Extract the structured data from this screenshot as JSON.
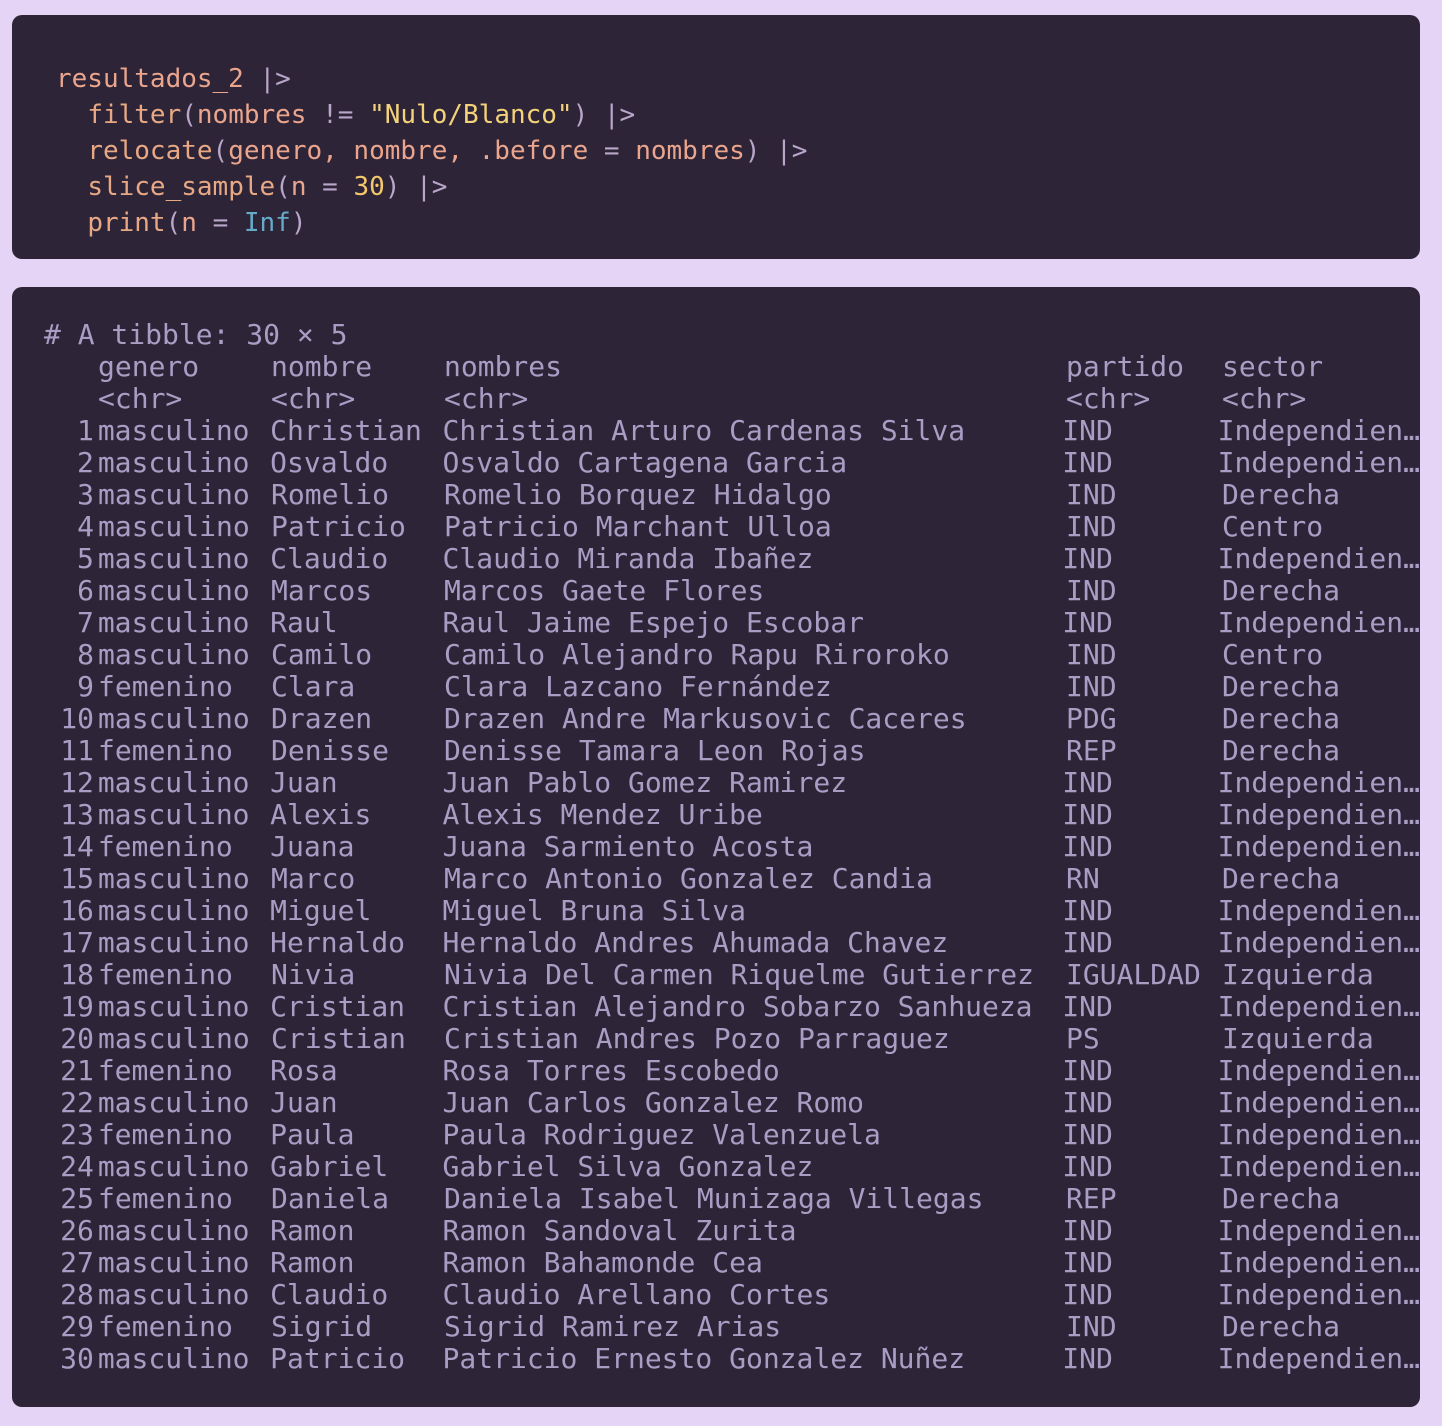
{
  "code": {
    "object": "resultados_2",
    "pipe": "|>",
    "filter_fn": "filter",
    "filter_col": "nombres",
    "filter_op": "!=",
    "filter_value": "\"Nulo/Blanco\"",
    "relocate_fn": "relocate",
    "relocate_args": "genero, nombre, .before",
    "relocate_eq": "=",
    "relocate_target": "nombres",
    "slice_fn": "slice_sample",
    "slice_arg": "n",
    "slice_eq": "=",
    "slice_value": "30",
    "print_fn": "print",
    "print_arg": "n",
    "print_eq": "=",
    "print_value": "Inf"
  },
  "output": {
    "header": "# A tibble: 30 × 5",
    "columns": [
      "genero",
      "nombre",
      "nombres",
      "partido",
      "sector"
    ],
    "types": [
      "<chr>",
      "<chr>",
      "<chr>",
      "<chr>",
      "<chr>"
    ],
    "rows": [
      [
        "1",
        "masculino",
        "Christian",
        "Christian Arturo Cardenas Silva",
        "IND",
        "Independien…"
      ],
      [
        "2",
        "masculino",
        "Osvaldo",
        "Osvaldo Cartagena Garcia",
        "IND",
        "Independien…"
      ],
      [
        "3",
        "masculino",
        "Romelio",
        "Romelio Borquez Hidalgo",
        "IND",
        "Derecha"
      ],
      [
        "4",
        "masculino",
        "Patricio",
        "Patricio Marchant Ulloa",
        "IND",
        "Centro"
      ],
      [
        "5",
        "masculino",
        "Claudio",
        "Claudio Miranda Ibañez",
        "IND",
        "Independien…"
      ],
      [
        "6",
        "masculino",
        "Marcos",
        "Marcos Gaete Flores",
        "IND",
        "Derecha"
      ],
      [
        "7",
        "masculino",
        "Raul",
        "Raul Jaime Espejo Escobar",
        "IND",
        "Independien…"
      ],
      [
        "8",
        "masculino",
        "Camilo",
        "Camilo Alejandro Rapu Riroroko",
        "IND",
        "Centro"
      ],
      [
        "9",
        "femenino",
        "Clara",
        "Clara Lazcano Fernández",
        "IND",
        "Derecha"
      ],
      [
        "10",
        "masculino",
        "Drazen",
        "Drazen Andre Markusovic Caceres",
        "PDG",
        "Derecha"
      ],
      [
        "11",
        "femenino",
        "Denisse",
        "Denisse Tamara Leon Rojas",
        "REP",
        "Derecha"
      ],
      [
        "12",
        "masculino",
        "Juan",
        "Juan Pablo Gomez Ramirez",
        "IND",
        "Independien…"
      ],
      [
        "13",
        "masculino",
        "Alexis",
        "Alexis Mendez Uribe",
        "IND",
        "Independien…"
      ],
      [
        "14",
        "femenino",
        "Juana",
        "Juana Sarmiento Acosta",
        "IND",
        "Independien…"
      ],
      [
        "15",
        "masculino",
        "Marco",
        "Marco Antonio Gonzalez Candia",
        "RN",
        "Derecha"
      ],
      [
        "16",
        "masculino",
        "Miguel",
        "Miguel Bruna Silva",
        "IND",
        "Independien…"
      ],
      [
        "17",
        "masculino",
        "Hernaldo",
        "Hernaldo Andres Ahumada Chavez",
        "IND",
        "Independien…"
      ],
      [
        "18",
        "femenino",
        "Nivia",
        "Nivia Del Carmen Riquelme Gutierrez",
        "IGUALDAD",
        "Izquierda"
      ],
      [
        "19",
        "masculino",
        "Cristian",
        "Cristian Alejandro Sobarzo Sanhueza",
        "IND",
        "Independien…"
      ],
      [
        "20",
        "masculino",
        "Cristian",
        "Cristian Andres Pozo Parraguez",
        "PS",
        "Izquierda"
      ],
      [
        "21",
        "femenino",
        "Rosa",
        "Rosa Torres Escobedo",
        "IND",
        "Independien…"
      ],
      [
        "22",
        "masculino",
        "Juan",
        "Juan Carlos Gonzalez Romo",
        "IND",
        "Independien…"
      ],
      [
        "23",
        "femenino",
        "Paula",
        "Paula Rodriguez Valenzuela",
        "IND",
        "Independien…"
      ],
      [
        "24",
        "masculino",
        "Gabriel",
        "Gabriel Silva Gonzalez",
        "IND",
        "Independien…"
      ],
      [
        "25",
        "femenino",
        "Daniela",
        "Daniela Isabel Munizaga Villegas",
        "REP",
        "Derecha"
      ],
      [
        "26",
        "masculino",
        "Ramon",
        "Ramon Sandoval Zurita",
        "IND",
        "Independien…"
      ],
      [
        "27",
        "masculino",
        "Ramon",
        "Ramon Bahamonde Cea",
        "IND",
        "Independien…"
      ],
      [
        "28",
        "masculino",
        "Claudio",
        "Claudio Arellano Cortes",
        "IND",
        "Independien…"
      ],
      [
        "29",
        "femenino",
        "Sigrid",
        "Sigrid Ramirez Arias",
        "IND",
        "Derecha"
      ],
      [
        "30",
        "masculino",
        "Patricio",
        "Patricio Ernesto Gonzalez Nuñez",
        "IND",
        "Independien…"
      ]
    ]
  }
}
